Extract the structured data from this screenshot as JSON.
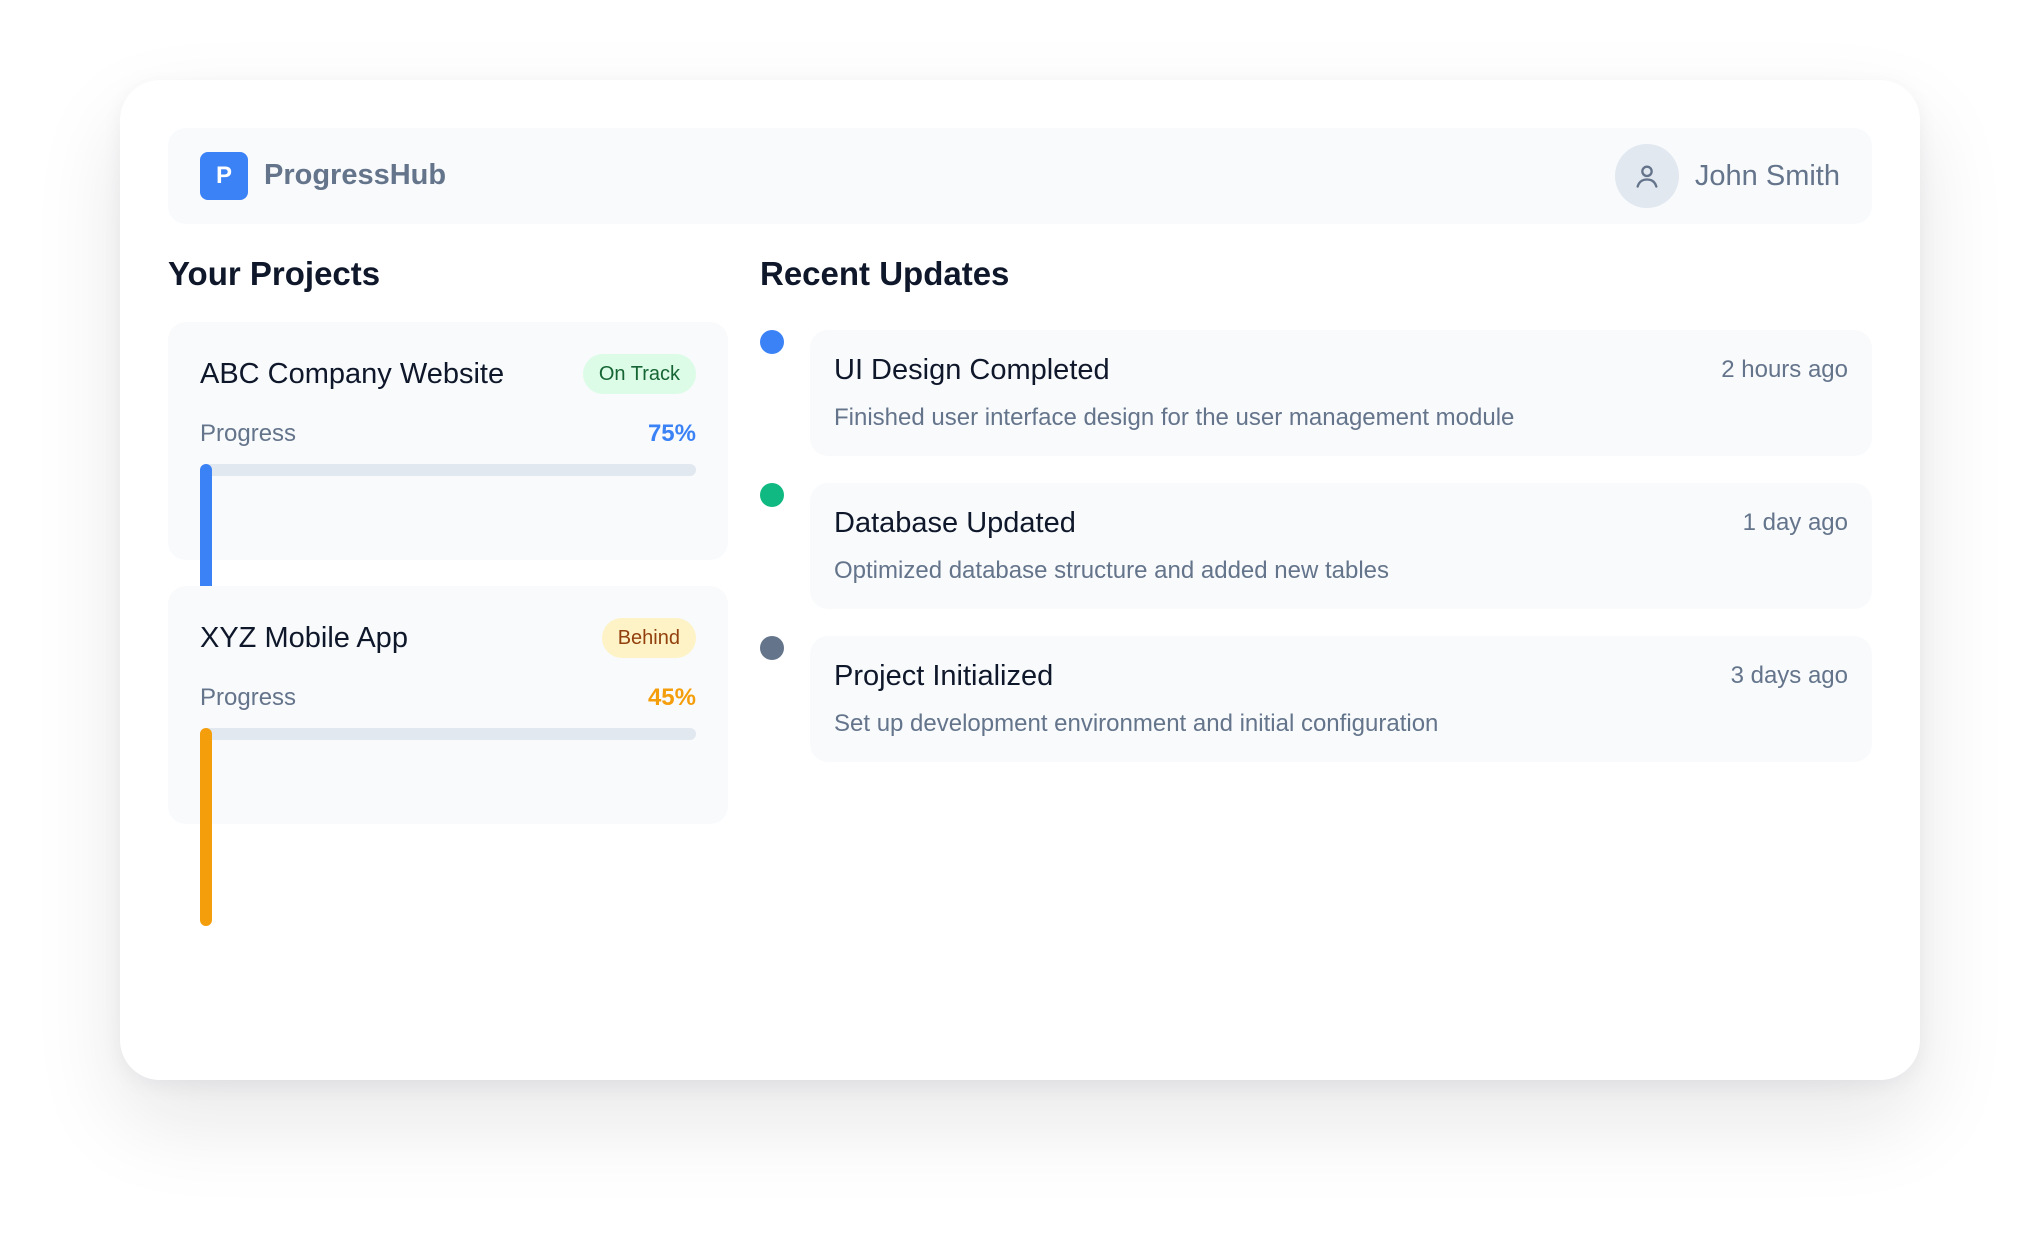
{
  "header": {
    "logo_letter": "P",
    "app_name": "ProgressHub",
    "user_name": "John Smith",
    "logo_color": "#3b82f6",
    "avatar_icon": "user-icon"
  },
  "projects": {
    "title": "Your Projects",
    "items": [
      {
        "name": "ABC Company Website",
        "status": "On Track",
        "status_bg": "#dcfce7",
        "status_color": "#166534",
        "progress_label": "Progress",
        "progress_text": "75%",
        "progress": 0.75,
        "accent": "#3b82f6"
      },
      {
        "name": "XYZ Mobile App",
        "status": "Behind",
        "status_bg": "#fef3c7",
        "status_color": "#92400e",
        "progress_label": "Progress",
        "progress_text": "45%",
        "progress": 0.45,
        "accent": "#f59e0b"
      }
    ]
  },
  "updates": {
    "title": "Recent Updates",
    "items": [
      {
        "title": "UI Design Completed",
        "time": "2 hours ago",
        "description": "Finished user interface design for the user management module",
        "dot_color": "#3b82f6"
      },
      {
        "title": "Database Updated",
        "time": "1 day ago",
        "description": "Optimized database structure and added new tables",
        "dot_color": "#10b981"
      },
      {
        "title": "Project Initialized",
        "time": "3 days ago",
        "description": "Set up development environment and initial configuration",
        "dot_color": "#64748b"
      }
    ]
  }
}
